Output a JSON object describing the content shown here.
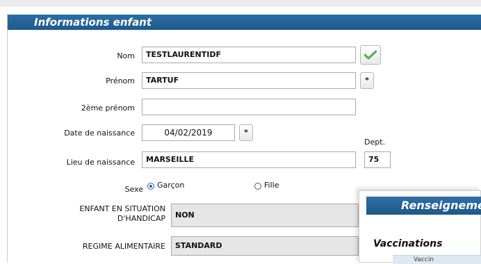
{
  "section": {
    "title": "Informations enfant"
  },
  "fields": {
    "nom": {
      "label": "Nom",
      "value": "TESTLAURENTIDF"
    },
    "prenom": {
      "label": "Prénom",
      "value": "TARTUF",
      "required_mark": "*"
    },
    "deuxieme_prenom": {
      "label": "2ème prénom",
      "value": ""
    },
    "date_naissance": {
      "label": "Date de naissance",
      "value": "04/02/2019",
      "required_mark": "*"
    },
    "lieu_naissance": {
      "label": "Lieu de naissance",
      "value": "MARSEILLE"
    },
    "dept": {
      "label": "Dept.",
      "value": "75"
    },
    "sexe": {
      "label": "Sexe",
      "options": [
        {
          "label": "Garçon",
          "selected": true
        },
        {
          "label": "Fille",
          "selected": false
        }
      ]
    },
    "handicap": {
      "label": "ENFANT EN SITUATION D'HANDICAP",
      "value": "NON"
    },
    "regime": {
      "label": "REGIME ALIMENTAIRE",
      "value": "STANDARD"
    }
  },
  "popup": {
    "title": "Renseigneme",
    "section": "Vaccinations",
    "table_header": "Vaccin"
  },
  "icons": {
    "nom_status": "checkmark-icon"
  },
  "colors": {
    "header_blue": "#1e5a8c",
    "check_green": "#4cae4c",
    "radio_blue": "#1f5fb0"
  }
}
